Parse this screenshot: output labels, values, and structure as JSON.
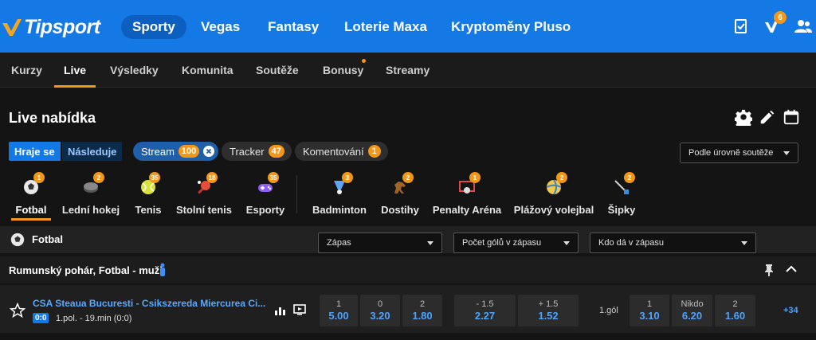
{
  "header": {
    "brand": "Tipsport",
    "nav": [
      {
        "label": "Sporty",
        "active": true
      },
      {
        "label": "Vegas"
      },
      {
        "label": "Fantasy"
      },
      {
        "label": "Loterie Maxa"
      },
      {
        "label": "Kryptoměny Pluso"
      }
    ],
    "ticket_badge": "6"
  },
  "subnav": {
    "items": [
      "Kurzy",
      "Live",
      "Výsledky",
      "Komunita",
      "Soutěže",
      "Bonusy",
      "Streamy"
    ],
    "active": "Live"
  },
  "live": {
    "title": "Live nabídka",
    "toggle": {
      "a": "Hraje se",
      "b": "Následuje"
    },
    "chips": [
      {
        "label": "Stream",
        "count": "100"
      },
      {
        "label": "Tracker",
        "count": "47"
      },
      {
        "label": "Komentování",
        "count": "1"
      }
    ],
    "level_dropdown": "Podle úrovně soutěže"
  },
  "sports": [
    {
      "label": "Fotbal",
      "count": "1",
      "icon": "soccer-ball-icon"
    },
    {
      "label": "Lední hokej",
      "count": "2",
      "icon": "hockey-puck-icon"
    },
    {
      "label": "Tenis",
      "count": "35",
      "icon": "tennis-ball-icon"
    },
    {
      "label": "Stolní tenis",
      "count": "18",
      "icon": "table-tennis-icon"
    },
    {
      "label": "Esporty",
      "count": "35",
      "icon": "gamepad-icon"
    },
    {
      "label": "Badminton",
      "count": "3",
      "icon": "shuttlecock-icon"
    },
    {
      "label": "Dostihy",
      "count": "2",
      "icon": "horse-icon"
    },
    {
      "label": "Penalty Aréna",
      "count": "1",
      "icon": "penalty-icon"
    },
    {
      "label": "Plážový volejbal",
      "count": "2",
      "icon": "volleyball-icon"
    },
    {
      "label": "Šipky",
      "count": "2",
      "icon": "dart-icon"
    }
  ],
  "section": {
    "sport": "Fotbal",
    "dropdowns": [
      "Zápas",
      "Počet gólů v zápasu",
      "Kdo dá v zápasu"
    ]
  },
  "league": {
    "name": "Rumunský pohár, Fotbal - muži"
  },
  "match": {
    "teams": "CSA Steaua Bucuresti - Csikszereda Miercurea Ci...",
    "score": "0:0",
    "time": "1.pol. - 19.min (0:0)",
    "odds_1x2": [
      {
        "label": "1",
        "value": "5.00"
      },
      {
        "label": "0",
        "value": "3.20"
      },
      {
        "label": "2",
        "value": "1.80"
      }
    ],
    "odds_goals": [
      {
        "label": "- 1.5",
        "value": "2.27"
      },
      {
        "label": "+ 1.5",
        "value": "1.52"
      }
    ],
    "first_goal_label": "1.gól",
    "odds_scorer": [
      {
        "label": "1",
        "value": "3.10"
      },
      {
        "label": "Nikdo",
        "value": "6.20"
      },
      {
        "label": "2",
        "value": "1.60"
      }
    ],
    "more": "+34"
  },
  "colors": {
    "brand_blue": "#1479e5",
    "accent_orange": "#f29718",
    "odd_blue": "#4da3ff"
  }
}
